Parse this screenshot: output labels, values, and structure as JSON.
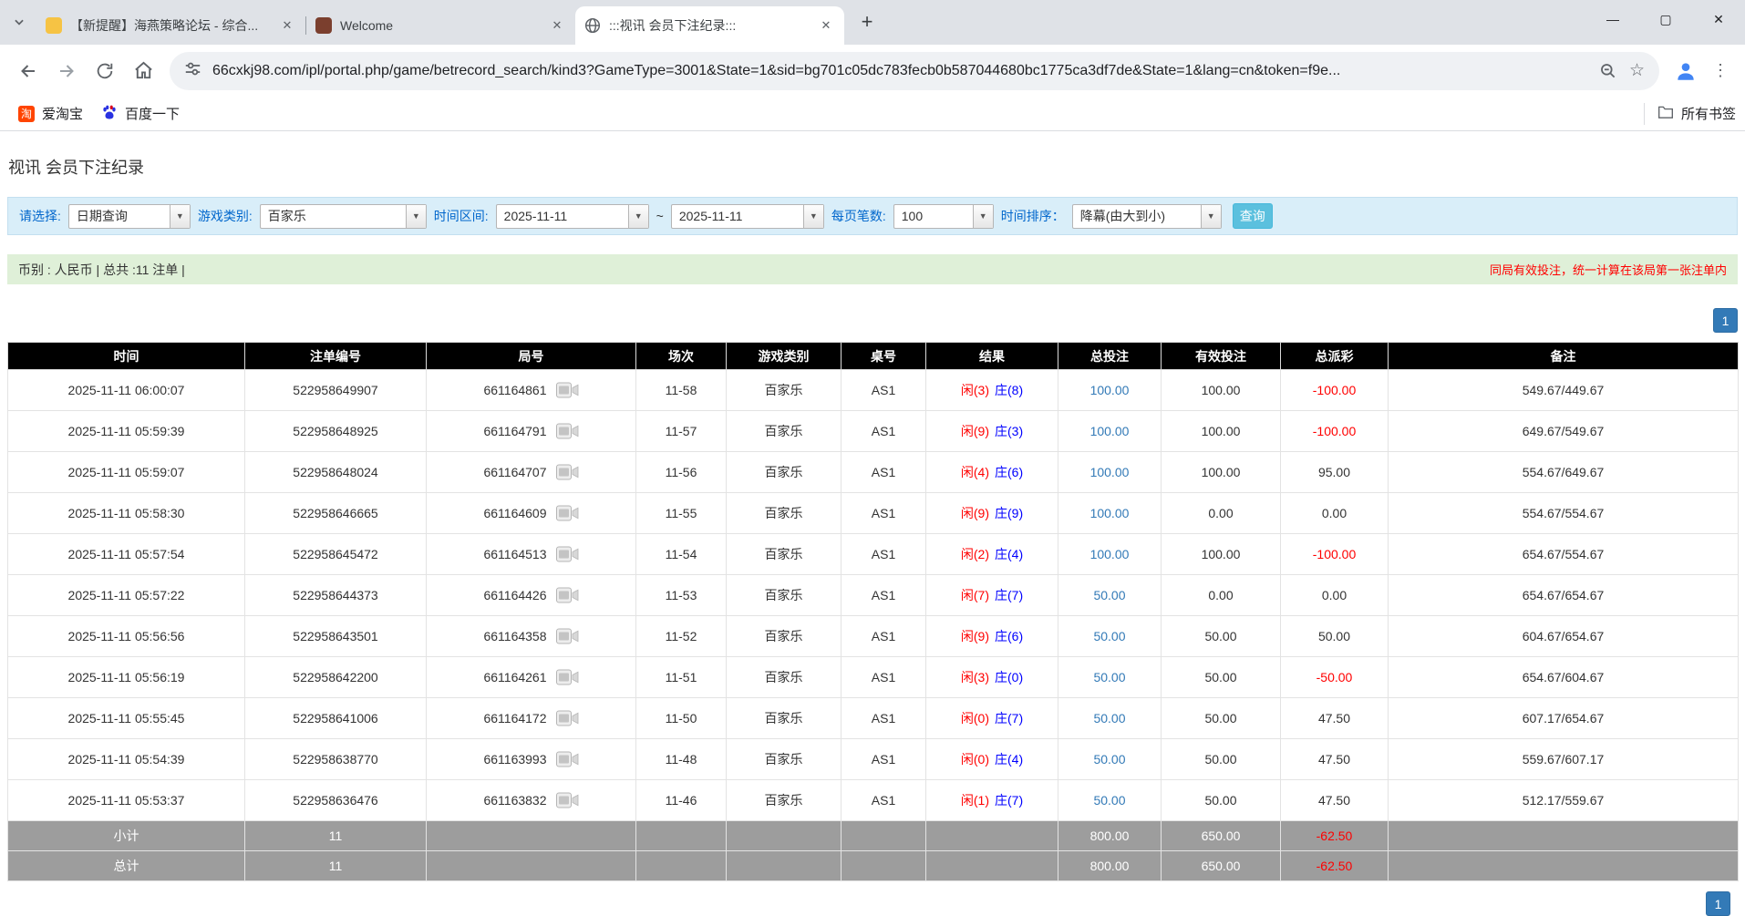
{
  "colors": {
    "accent_blue": "#337ab7",
    "link_blue": "#337ab7",
    "negative_red": "#ff0000",
    "player_red": "#ff0000",
    "banker_blue": "#0000ff",
    "table_header_bg": "#000000",
    "table_footer_bg": "#9d9d9d",
    "filter_bar_bg": "#d9eef9",
    "summary_bar_bg": "#dff0d8",
    "search_button_bg": "#5bc0de"
  },
  "browser": {
    "tabs": [
      {
        "title": "【新提醒】海燕策略论坛 - 综合...",
        "icon": "yellow-site-icon"
      },
      {
        "title": "Welcome",
        "icon": "maroon-site-icon"
      },
      {
        "title": ":::视讯 会员下注纪录:::",
        "icon": "globe-icon"
      }
    ],
    "url": "66cxkj98.com/ipl/portal.php/game/betrecord_search/kind3?GameType=3001&State=1&sid=bg701c05dc783fecb0b587044680bc1775ca3df7de&State=1&lang=cn&token=f9e...",
    "bookmarks": [
      {
        "label": "爱淘宝",
        "icon_text": "淘"
      },
      {
        "label": "百度一下"
      }
    ],
    "all_bookmarks_label": "所有书签"
  },
  "page": {
    "title": "视讯 会员下注纪录",
    "filters": {
      "select_label": "请选择:",
      "select_value": "日期查询",
      "game_label": "游戏类别:",
      "game_value": "百家乐",
      "range_label": "时间区间:",
      "date_from": "2025-11-11",
      "tilde": "~",
      "date_to": "2025-11-11",
      "per_page_label": "每页笔数:",
      "per_page_value": "100",
      "sort_label": "时间排序：",
      "sort_value": "降幕(由大到小)",
      "search_button": "查询"
    },
    "summary": {
      "left": "币别 : 人民币 | 总共 :11 注单 |",
      "notice": "同局有效投注，统一计算在该局第一张注单内"
    },
    "pagination": {
      "current": "1"
    },
    "table": {
      "headers": [
        "时间",
        "注单编号",
        "局号",
        "场次",
        "游戏类别",
        "桌号",
        "结果",
        "总投注",
        "有效投注",
        "总派彩",
        "备注"
      ],
      "rows": [
        {
          "time": "2025-11-11 06:00:07",
          "bet_id": "522958649907",
          "round": "661164861",
          "session": "11-58",
          "game": "百家乐",
          "table_no": "AS1",
          "player": "闲(3)",
          "banker": "庄(8)",
          "total_bet": "100.00",
          "valid_bet": "100.00",
          "payout": "-100.00",
          "remark": "549.67/449.67"
        },
        {
          "time": "2025-11-11 05:59:39",
          "bet_id": "522958648925",
          "round": "661164791",
          "session": "11-57",
          "game": "百家乐",
          "table_no": "AS1",
          "player": "闲(9)",
          "banker": "庄(3)",
          "total_bet": "100.00",
          "valid_bet": "100.00",
          "payout": "-100.00",
          "remark": "649.67/549.67"
        },
        {
          "time": "2025-11-11 05:59:07",
          "bet_id": "522958648024",
          "round": "661164707",
          "session": "11-56",
          "game": "百家乐",
          "table_no": "AS1",
          "player": "闲(4)",
          "banker": "庄(6)",
          "total_bet": "100.00",
          "valid_bet": "100.00",
          "payout": "95.00",
          "remark": "554.67/649.67"
        },
        {
          "time": "2025-11-11 05:58:30",
          "bet_id": "522958646665",
          "round": "661164609",
          "session": "11-55",
          "game": "百家乐",
          "table_no": "AS1",
          "player": "闲(9)",
          "banker": "庄(9)",
          "total_bet": "100.00",
          "valid_bet": "0.00",
          "payout": "0.00",
          "remark": "554.67/554.67"
        },
        {
          "time": "2025-11-11 05:57:54",
          "bet_id": "522958645472",
          "round": "661164513",
          "session": "11-54",
          "game": "百家乐",
          "table_no": "AS1",
          "player": "闲(2)",
          "banker": "庄(4)",
          "total_bet": "100.00",
          "valid_bet": "100.00",
          "payout": "-100.00",
          "remark": "654.67/554.67"
        },
        {
          "time": "2025-11-11 05:57:22",
          "bet_id": "522958644373",
          "round": "661164426",
          "session": "11-53",
          "game": "百家乐",
          "table_no": "AS1",
          "player": "闲(7)",
          "banker": "庄(7)",
          "total_bet": "50.00",
          "valid_bet": "0.00",
          "payout": "0.00",
          "remark": "654.67/654.67"
        },
        {
          "time": "2025-11-11 05:56:56",
          "bet_id": "522958643501",
          "round": "661164358",
          "session": "11-52",
          "game": "百家乐",
          "table_no": "AS1",
          "player": "闲(9)",
          "banker": "庄(6)",
          "total_bet": "50.00",
          "valid_bet": "50.00",
          "payout": "50.00",
          "remark": "604.67/654.67"
        },
        {
          "time": "2025-11-11 05:56:19",
          "bet_id": "522958642200",
          "round": "661164261",
          "session": "11-51",
          "game": "百家乐",
          "table_no": "AS1",
          "player": "闲(3)",
          "banker": "庄(0)",
          "total_bet": "50.00",
          "valid_bet": "50.00",
          "payout": "-50.00",
          "remark": "654.67/604.67"
        },
        {
          "time": "2025-11-11 05:55:45",
          "bet_id": "522958641006",
          "round": "661164172",
          "session": "11-50",
          "game": "百家乐",
          "table_no": "AS1",
          "player": "闲(0)",
          "banker": "庄(7)",
          "total_bet": "50.00",
          "valid_bet": "50.00",
          "payout": "47.50",
          "remark": "607.17/654.67"
        },
        {
          "time": "2025-11-11 05:54:39",
          "bet_id": "522958638770",
          "round": "661163993",
          "session": "11-48",
          "game": "百家乐",
          "table_no": "AS1",
          "player": "闲(0)",
          "banker": "庄(4)",
          "total_bet": "50.00",
          "valid_bet": "50.00",
          "payout": "47.50",
          "remark": "559.67/607.17"
        },
        {
          "time": "2025-11-11 05:53:37",
          "bet_id": "522958636476",
          "round": "661163832",
          "session": "11-46",
          "game": "百家乐",
          "table_no": "AS1",
          "player": "闲(1)",
          "banker": "庄(7)",
          "total_bet": "50.00",
          "valid_bet": "50.00",
          "payout": "47.50",
          "remark": "512.17/559.67"
        }
      ],
      "subtotal": {
        "label": "小计",
        "count": "11",
        "total_bet": "800.00",
        "valid_bet": "650.00",
        "payout": "-62.50"
      },
      "grand_total": {
        "label": "总计",
        "count": "11",
        "total_bet": "800.00",
        "valid_bet": "650.00",
        "payout": "-62.50"
      }
    }
  }
}
